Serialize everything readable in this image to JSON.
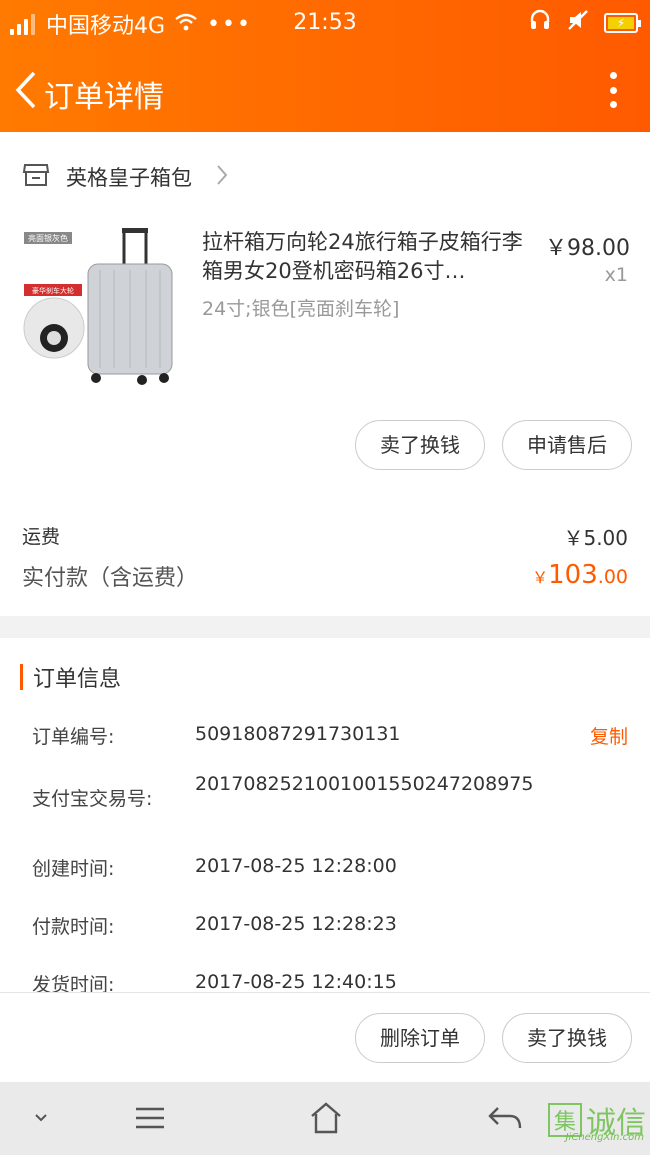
{
  "status_bar": {
    "carrier": "中国移动4G",
    "time": "21:53",
    "more": "•••"
  },
  "header": {
    "title": "订单详情"
  },
  "shop": {
    "name": "英格皇子箱包"
  },
  "product": {
    "image_tag": "亮面银灰色",
    "image_badge": "豪华刹车大轮",
    "title": "拉杆箱万向轮24旅行箱子皮箱行李箱男女20登机密码箱26寸…",
    "spec": "24寸;银色[亮面刹车轮]",
    "price": "￥98.00",
    "quantity": "x1"
  },
  "item_actions": {
    "sell_label": "卖了换钱",
    "after_sale_label": "申请售后"
  },
  "summary": {
    "shipping_label": "运费",
    "shipping_value": "￥5.00",
    "paid_label": "实付款（含运费）",
    "paid_currency": "￥",
    "paid_integer": "103",
    "paid_decimal": ".00"
  },
  "order_info": {
    "title": "订单信息",
    "copy_label": "复制",
    "rows": [
      {
        "label": "订单编号:",
        "value": "50918087291730131"
      },
      {
        "label": "支付宝交易号:",
        "value": "2017082521001001550247208975"
      },
      {
        "label": "创建时间:",
        "value": "2017-08-25 12:28:00"
      },
      {
        "label": "付款时间:",
        "value": "2017-08-25 12:28:23"
      },
      {
        "label": "发货时间:",
        "value": "2017-08-25 12:40:15"
      }
    ]
  },
  "bottom_actions": {
    "delete_label": "删除订单",
    "sell_label": "卖了换钱"
  },
  "watermark": {
    "chars": "集诚信",
    "site": "JiChengXin.com"
  },
  "colors": {
    "accent": "#ff5a00",
    "header_gradient_start": "#ff7a00",
    "header_gradient_end": "#ff5a00"
  },
  "icons": [
    "back-arrow-icon",
    "more-vertical-icon",
    "shop-icon",
    "chevron-right-icon",
    "wifi-icon",
    "headset-icon",
    "mute-icon",
    "battery-icon",
    "nav-down-icon",
    "nav-menu-icon",
    "nav-home-icon",
    "nav-back-icon"
  ]
}
